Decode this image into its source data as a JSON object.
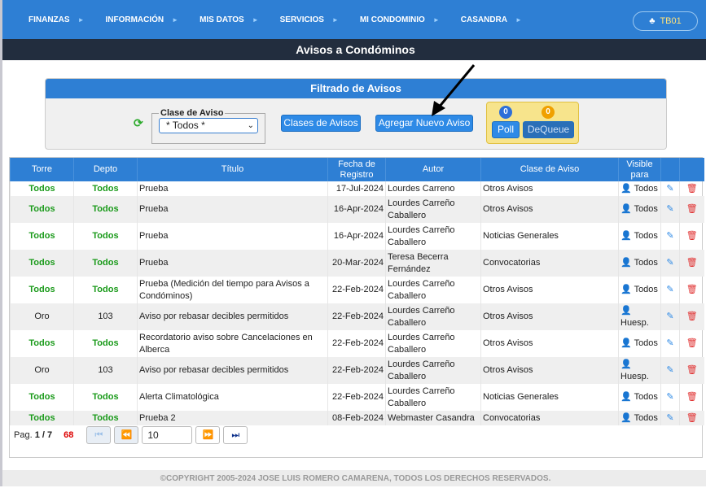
{
  "nav": {
    "items": [
      "FINANZAS",
      "INFORMACIÓN",
      "MIS DATOS",
      "SERVICIOS",
      "MI CONDOMINIO",
      "CASANDRA"
    ],
    "user": "TB01"
  },
  "page_title": "Avisos a Condóminos",
  "filter": {
    "title": "Filtrado de Avisos",
    "clase_label": "Clase de Aviso",
    "clase_value": "* Todos *",
    "clases_button": "Clases de Avisos",
    "agregar_button": "Agregar Nuevo Aviso",
    "poll_count": "0",
    "dequeue_count": "0",
    "poll_button": "Poll",
    "dequeue_button": "DeQueue"
  },
  "table": {
    "headers": [
      "Torre",
      "Depto",
      "Título",
      "Fecha de Registro",
      "Autor",
      "Clase de Aviso",
      "Visible para"
    ],
    "rows": [
      {
        "torre": "Todos",
        "depto": "Todos",
        "titulo": "Prueba",
        "fecha": "17-Jul-2024",
        "autor": "Lourdes Carreno",
        "clase": "Otros Avisos",
        "visible": "Todos"
      },
      {
        "torre": "Todos",
        "depto": "Todos",
        "titulo": "Prueba",
        "fecha": "16-Apr-2024",
        "autor": "Lourdes Carreño Caballero",
        "clase": "Otros Avisos",
        "visible": "Todos"
      },
      {
        "torre": "Todos",
        "depto": "Todos",
        "titulo": "Prueba",
        "fecha": "16-Apr-2024",
        "autor": "Lourdes Carreño Caballero",
        "clase": "Noticias Generales",
        "visible": "Todos"
      },
      {
        "torre": "Todos",
        "depto": "Todos",
        "titulo": "Prueba",
        "fecha": "20-Mar-2024",
        "autor": "Teresa Becerra Fernández",
        "clase": "Convocatorias",
        "visible": "Todos"
      },
      {
        "torre": "Todos",
        "depto": "Todos",
        "titulo": "Prueba (Medición del tiempo para Avisos a Condóminos)",
        "fecha": "22-Feb-2024",
        "autor": "Lourdes Carreño Caballero",
        "clase": "Otros Avisos",
        "visible": "Todos"
      },
      {
        "torre": "Oro",
        "depto": "103",
        "titulo": "Aviso por rebasar decibles permitidos",
        "fecha": "22-Feb-2024",
        "autor": "Lourdes Carreño Caballero",
        "clase": "Otros Avisos",
        "visible": "Huesp."
      },
      {
        "torre": "Todos",
        "depto": "Todos",
        "titulo": "Recordatorio aviso sobre Cancelaciones en Alberca",
        "fecha": "22-Feb-2024",
        "autor": "Lourdes Carreño Caballero",
        "clase": "Otros Avisos",
        "visible": "Todos"
      },
      {
        "torre": "Oro",
        "depto": "103",
        "titulo": "Aviso por rebasar decibles permitidos",
        "fecha": "22-Feb-2024",
        "autor": "Lourdes Carreño Caballero",
        "clase": "Otros Avisos",
        "visible": "Huesp."
      },
      {
        "torre": "Todos",
        "depto": "Todos",
        "titulo": "Alerta Climatológica",
        "fecha": "22-Feb-2024",
        "autor": "Lourdes Carreño Caballero",
        "clase": "Noticias Generales",
        "visible": "Todos"
      },
      {
        "torre": "Todos",
        "depto": "Todos",
        "titulo": "Prueba 2",
        "fecha": "08-Feb-2024",
        "autor": "Webmaster Casandra",
        "clase": "Convocatorias",
        "visible": "Todos"
      }
    ]
  },
  "pager": {
    "label": "Pag.",
    "page": "1 / 7",
    "total": "68",
    "page_size": "10"
  },
  "footer": "©COPYRIGHT 2005-2024 JOSE LUIS ROMERO CAMARENA, TODOS LOS DERECHOS RESERVADOS.",
  "colors": {
    "nav": "#2e7fd4",
    "titlebar": "#222d3e",
    "green": "#1a9a1a",
    "red": "#cc0000"
  }
}
